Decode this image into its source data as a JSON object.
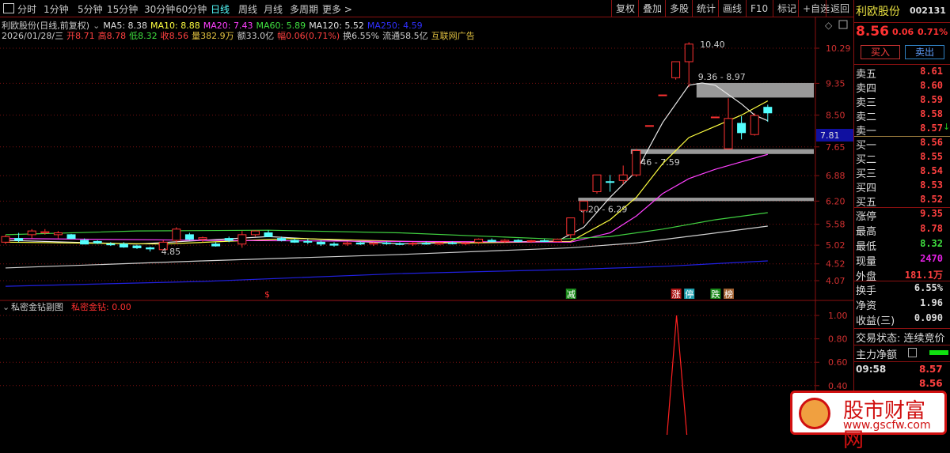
{
  "toolbar": {
    "periods": [
      "分时",
      "1分钟",
      "5分钟",
      "15分钟",
      "30分钟",
      "60分钟",
      "日线",
      "周线",
      "月线",
      "多周期",
      "更多 >"
    ],
    "active": "日线",
    "tools": [
      "复权",
      "叠加",
      "多股",
      "统计",
      "画线",
      "F10",
      "标记",
      "+自选",
      "返回"
    ]
  },
  "header": {
    "title": "利欧股份(日线,前复权)",
    "ma": [
      {
        "label": "MA5: 8.38",
        "color": "#e0e0e0"
      },
      {
        "label": "MA10: 8.88",
        "color": "#ffff40"
      },
      {
        "label": "MA20: 7.43",
        "color": "#ff40ff"
      },
      {
        "label": "MA60: 5.89",
        "color": "#40e040"
      },
      {
        "label": "MA120: 5.52",
        "color": "#e0e0e0"
      },
      {
        "label": "MA250: 4.59",
        "color": "#3030ff"
      }
    ],
    "ohlc": [
      {
        "t": "2026/01/28/三",
        "c": "#ccc"
      },
      {
        "t": "开8.71",
        "c": "#ff4040"
      },
      {
        "t": "高8.78",
        "c": "#ff4040"
      },
      {
        "t": "低8.32",
        "c": "#40e040"
      },
      {
        "t": "收8.56",
        "c": "#ff4040"
      },
      {
        "t": "量382.9万",
        "c": "#e0c040"
      },
      {
        "t": "额33.0亿",
        "c": "#ccc"
      },
      {
        "t": "幅0.06(0.71%)",
        "c": "#ff4040"
      },
      {
        "t": "换6.55%",
        "c": "#ccc"
      },
      {
        "t": "流通58.5亿",
        "c": "#ccc"
      },
      {
        "t": "互联网广告",
        "c": "#e0c040"
      }
    ]
  },
  "chart_data": {
    "type": "candlestick",
    "price_range": [
      4.07,
      10.29
    ],
    "y_ticks": [
      "10.29",
      "9.35",
      "8.50",
      "7.65",
      "6.88",
      "6.20",
      "5.58",
      "5.02",
      "4.52",
      "4.07"
    ],
    "current_price_tag": "7.81",
    "candles": [
      [
        5.1,
        5.3,
        5.05,
        5.25
      ],
      [
        5.2,
        5.35,
        5.1,
        5.15
      ],
      [
        5.3,
        5.45,
        5.2,
        5.4
      ],
      [
        5.35,
        5.45,
        5.3,
        5.38
      ],
      [
        5.3,
        5.4,
        5.2,
        5.35
      ],
      [
        5.3,
        5.32,
        5.18,
        5.2
      ],
      [
        5.15,
        5.2,
        5.05,
        5.05
      ],
      [
        5.12,
        5.15,
        5.05,
        5.08
      ],
      [
        5.05,
        5.1,
        5.0,
        5.03
      ],
      [
        5.05,
        5.1,
        4.95,
        4.97
      ],
      [
        5.0,
        5.02,
        4.92,
        4.95
      ],
      [
        4.95,
        4.98,
        4.85,
        4.92
      ],
      [
        4.9,
        5.15,
        4.88,
        5.1
      ],
      [
        5.15,
        5.5,
        5.05,
        5.45
      ],
      [
        5.3,
        5.35,
        5.15,
        5.18
      ],
      [
        5.18,
        5.25,
        5.1,
        5.22
      ],
      [
        5.05,
        5.1,
        4.98,
        5.0
      ],
      [
        5.2,
        5.25,
        5.1,
        5.15
      ],
      [
        5.05,
        5.4,
        4.95,
        5.3
      ],
      [
        5.3,
        5.42,
        5.25,
        5.4
      ],
      [
        5.35,
        5.42,
        5.3,
        5.25
      ],
      [
        5.2,
        5.25,
        5.12,
        5.15
      ],
      [
        5.15,
        5.2,
        5.08,
        5.1
      ],
      [
        5.12,
        5.18,
        5.05,
        5.1
      ],
      [
        5.1,
        5.15,
        5.0,
        5.05
      ],
      [
        5.05,
        5.1,
        4.98,
        5.02
      ],
      [
        5.05,
        5.12,
        5.0,
        5.08
      ],
      [
        5.08,
        5.12,
        5.02,
        5.05
      ],
      [
        5.05,
        5.1,
        5.0,
        5.08
      ],
      [
        5.08,
        5.12,
        5.03,
        5.06
      ],
      [
        5.06,
        5.1,
        5.02,
        5.05
      ],
      [
        5.05,
        5.1,
        5.0,
        5.07
      ],
      [
        5.07,
        5.12,
        5.03,
        5.05
      ],
      [
        5.05,
        5.1,
        5.02,
        5.08
      ],
      [
        5.08,
        5.12,
        5.04,
        5.06
      ],
      [
        5.06,
        5.1,
        5.02,
        5.08
      ],
      [
        5.1,
        5.2,
        5.05,
        5.18
      ],
      [
        5.15,
        5.2,
        5.1,
        5.12
      ],
      [
        5.12,
        5.18,
        5.08,
        5.15
      ],
      [
        5.15,
        5.18,
        5.1,
        5.12
      ],
      [
        5.12,
        5.16,
        5.08,
        5.14
      ],
      [
        5.14,
        5.18,
        5.1,
        5.12
      ],
      [
        5.12,
        5.2,
        5.1,
        5.18
      ],
      [
        5.3,
        5.75,
        5.2,
        5.75
      ],
      [
        5.95,
        6.2,
        5.6,
        6.2
      ],
      [
        6.45,
        6.7,
        6.4,
        6.9
      ],
      [
        6.72,
        6.9,
        6.45,
        6.7
      ],
      [
        6.75,
        7.15,
        6.65,
        6.9
      ],
      [
        6.9,
        7.6,
        6.85,
        7.55
      ],
      [
        8.22,
        8.22,
        8.22,
        8.22
      ],
      [
        9.04,
        9.04,
        9.04,
        9.04
      ],
      [
        9.5,
        9.93,
        9.45,
        9.93
      ],
      [
        9.93,
        10.45,
        9.25,
        10.4
      ],
      null,
      [
        8.45,
        8.45,
        8.45,
        8.45
      ],
      [
        7.6,
        8.95,
        7.58,
        8.41
      ],
      [
        8.28,
        8.47,
        7.85,
        8.03
      ],
      [
        7.98,
        8.55,
        7.95,
        8.49
      ],
      [
        8.71,
        8.78,
        8.32,
        8.56
      ]
    ],
    "ma_lines": [
      {
        "name": "MA5",
        "color": "#e8e8e8",
        "pts": [
          [
            0,
            5.15
          ],
          [
            10,
            5.05
          ],
          [
            20,
            5.25
          ],
          [
            30,
            5.06
          ],
          [
            42,
            5.13
          ],
          [
            44,
            5.5
          ],
          [
            46,
            6.3
          ],
          [
            48,
            7.0
          ],
          [
            50,
            8.3
          ],
          [
            52,
            9.3
          ],
          [
            53,
            9.36
          ],
          [
            54,
            9.3
          ],
          [
            56,
            8.8
          ],
          [
            57,
            8.5
          ],
          [
            58,
            8.35
          ]
        ]
      },
      {
        "name": "MA10",
        "color": "#ffff40",
        "pts": [
          [
            0,
            5.1
          ],
          [
            12,
            5.05
          ],
          [
            22,
            5.2
          ],
          [
            35,
            5.08
          ],
          [
            43,
            5.12
          ],
          [
            46,
            5.7
          ],
          [
            48,
            6.3
          ],
          [
            50,
            7.2
          ],
          [
            52,
            7.9
          ],
          [
            54,
            8.2
          ],
          [
            56,
            8.5
          ],
          [
            58,
            8.88
          ]
        ]
      },
      {
        "name": "MA20",
        "color": "#ff40ff",
        "pts": [
          [
            0,
            5.2
          ],
          [
            15,
            5.15
          ],
          [
            30,
            5.12
          ],
          [
            43,
            5.1
          ],
          [
            46,
            5.35
          ],
          [
            48,
            5.8
          ],
          [
            50,
            6.4
          ],
          [
            52,
            6.8
          ],
          [
            54,
            7.05
          ],
          [
            56,
            7.25
          ],
          [
            58,
            7.45
          ]
        ]
      },
      {
        "name": "MA60",
        "color": "#40d040",
        "pts": [
          [
            0,
            5.3
          ],
          [
            10,
            5.4
          ],
          [
            20,
            5.42
          ],
          [
            30,
            5.35
          ],
          [
            42,
            5.18
          ],
          [
            46,
            5.25
          ],
          [
            50,
            5.45
          ],
          [
            54,
            5.7
          ],
          [
            58,
            5.89
          ]
        ]
      },
      {
        "name": "MA120",
        "color": "#d0d0d0",
        "pts": [
          [
            0,
            4.41
          ],
          [
            15,
            4.6
          ],
          [
            30,
            4.77
          ],
          [
            43,
            4.95
          ],
          [
            48,
            5.08
          ],
          [
            53,
            5.3
          ],
          [
            58,
            5.53
          ]
        ]
      },
      {
        "name": "MA250",
        "color": "#2020e0",
        "pts": [
          [
            0,
            3.92
          ],
          [
            15,
            4.05
          ],
          [
            30,
            4.26
          ],
          [
            43,
            4.37
          ],
          [
            50,
            4.45
          ],
          [
            58,
            4.6
          ]
        ]
      }
    ],
    "gap_zones": [
      {
        "label": "9.36 - 8.97",
        "hi": 9.36,
        "lo": 8.97,
        "from": 53
      },
      {
        "label": "7.46 - 7.59",
        "hi": 7.59,
        "lo": 7.46,
        "from": 48
      },
      {
        "label": "6.20 - 6.29",
        "hi": 6.29,
        "lo": 6.2,
        "from": 44
      }
    ],
    "annotations": [
      {
        "label": "10.40",
        "i": 52,
        "p": 10.4
      },
      {
        "label": "4.85",
        "i": 11,
        "p": 4.85
      }
    ],
    "signals": [
      {
        "t": "$",
        "i": 20,
        "c": "#ff3030",
        "bg": "none"
      },
      {
        "t": "减",
        "i": 43,
        "c": "#fff",
        "bg": "#1a8a1a"
      },
      {
        "t": "涨",
        "i": 51,
        "c": "#fff",
        "bg": "#b01818"
      },
      {
        "t": "停",
        "i": 52,
        "c": "#fff",
        "bg": "#20a0b0"
      },
      {
        "t": "跌",
        "i": 54,
        "c": "#fff",
        "bg": "#1a8a1a"
      },
      {
        "t": "榜",
        "i": 55,
        "c": "#fff",
        "bg": "#a06030"
      }
    ],
    "sub": {
      "title": "私密金钻副图",
      "indicator": "私密金钻: 0.00",
      "y_ticks": [
        "1.00",
        "0.80",
        "0.60",
        "0.40"
      ],
      "range": [
        0,
        1
      ],
      "spike_index": 51,
      "spike_value": 1.0
    }
  },
  "panel": {
    "name": "利欧股份",
    "code": "002131",
    "price": "8.56",
    "change": "0.06",
    "pct": "0.71%",
    "buy": "买入",
    "sell": "卖出",
    "asks": [
      [
        "卖五",
        "8.61"
      ],
      [
        "卖四",
        "8.60"
      ],
      [
        "卖三",
        "8.59"
      ],
      [
        "卖二",
        "8.58"
      ],
      [
        "卖一",
        "8.57"
      ]
    ],
    "bids": [
      [
        "买一",
        "8.56"
      ],
      [
        "买二",
        "8.55"
      ],
      [
        "买三",
        "8.54"
      ],
      [
        "买四",
        "8.53"
      ],
      [
        "买五",
        "8.52"
      ]
    ],
    "stats": [
      [
        "涨停",
        "9.35",
        "#ff4040"
      ],
      [
        "最高",
        "8.78",
        "#ff4040"
      ],
      [
        "最低",
        "8.32",
        "#40e040"
      ],
      [
        "现量",
        "2470",
        "#e020e0"
      ],
      [
        "外盘",
        "181.1万",
        "#ff4040"
      ]
    ],
    "stats2": [
      [
        "换手",
        "6.55%"
      ],
      [
        "净资",
        "1.96"
      ],
      [
        "收益(三)",
        "0.090"
      ]
    ],
    "status": "交易状态: 连续竞价",
    "main_net": "主力净额",
    "ticks": [
      [
        "09:58",
        "8.57"
      ],
      [
        "",
        "8.56"
      ]
    ]
  },
  "watermark": {
    "name": "股市财富网",
    "url": "www.gscfw.com"
  }
}
